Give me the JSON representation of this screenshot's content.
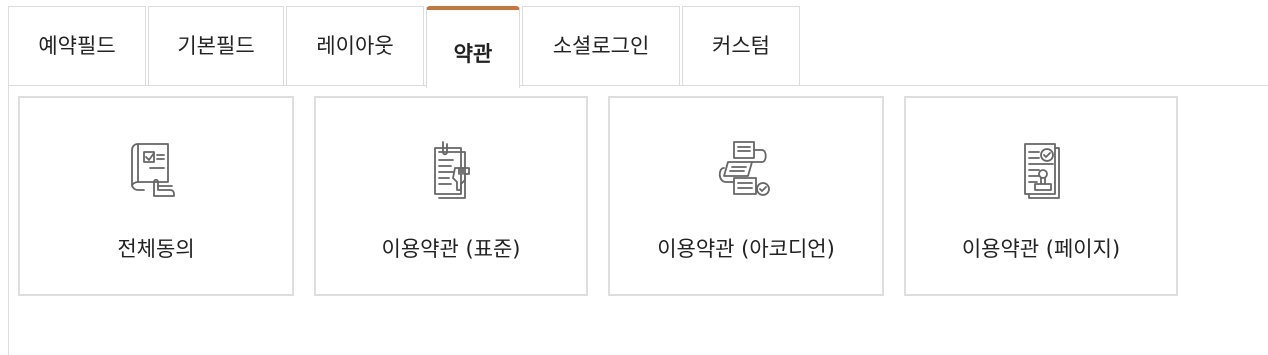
{
  "tabs": [
    {
      "label": "예약필드"
    },
    {
      "label": "기본필드"
    },
    {
      "label": "레이아웃"
    },
    {
      "label": "약관",
      "active": true
    },
    {
      "label": "소셜로그인"
    },
    {
      "label": "커스텀"
    }
  ],
  "cards": [
    {
      "label": "전체동의",
      "icon": "checklist-scroll-thumb-icon"
    },
    {
      "label": "이용약관 (표준)",
      "icon": "document-clip-hand-icon"
    },
    {
      "label": "이용약관 (아코디언)",
      "icon": "document-flow-check-icon"
    },
    {
      "label": "이용약관 (페이지)",
      "icon": "document-stamp-icon"
    }
  ],
  "colors": {
    "accent": "#c8763a",
    "border": "#dcdcdc",
    "icon": "#666666"
  }
}
